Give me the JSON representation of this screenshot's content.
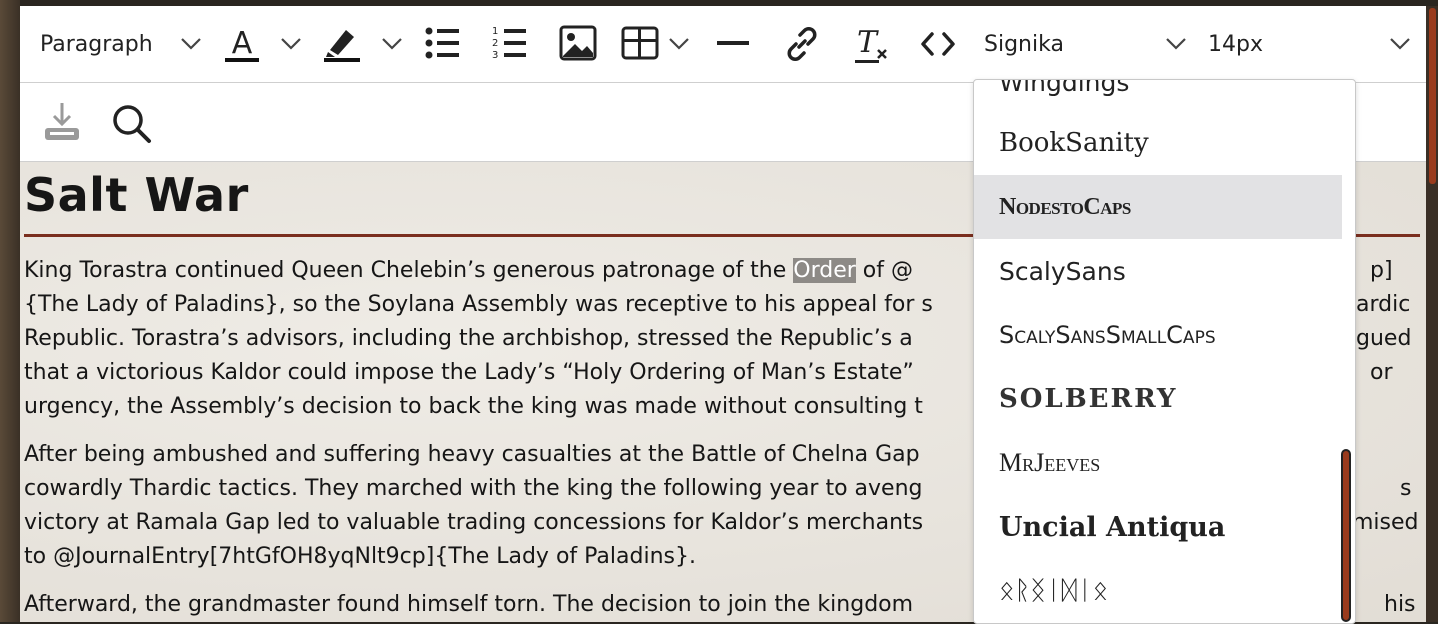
{
  "toolbar": {
    "block_format": "Paragraph",
    "font_family": "Signika",
    "font_size": "14px"
  },
  "document": {
    "title": "Salt War",
    "paragraph1": {
      "line1_before": "King Torastra continued Queen Chelebin’s generous patronage of the ",
      "line1_highlight": "Order",
      "line1_after": " of @",
      "line1_right": "p]",
      "line2": "{The Lady of Paladins}, so the Soylana Assembly was receptive to his appeal for s",
      "line2_right": "ardic",
      "line3": "Republic. Torastra’s advisors, including the archbishop, stressed the Republic’s a",
      "line3_right": "gued",
      "line4": "that a victorious Kaldor could impose the Lady’s “Holy Ordering of Man’s Estate”",
      "line4_right": "or",
      "line5": "urgency, the Assembly’s decision to back the king was made without consulting t"
    },
    "paragraph2": {
      "line1": "After being ambushed and suffering heavy casualties at the Battle of Chelna Gap",
      "line2": "cowardly Thardic tactics. They marched with the king the following year to aveng",
      "line2_right": "s",
      "line3": "victory at Ramala Gap led to valuable trading concessions for Kaldor’s merchants",
      "line3_right": "mised",
      "line4": "to @JournalEntry[7htGfOH8yqNlt9cp]{The Lady of Paladins}."
    },
    "paragraph3": {
      "line1": "Afterward, the grandmaster found himself torn. The decision to join the kingdom",
      "line1_right": "his"
    }
  },
  "font_dropdown": {
    "items": [
      "Wingdings",
      "BookSanity",
      "NodestoCaps",
      "ScalySans",
      "ScalySansSmallCaps",
      "SOLBERRY",
      "MrJeeves",
      "Uncial Antiqua",
      "ᛟᚱᛝᛁᛞᛁᛟ"
    ],
    "selected": "NodestoCaps"
  },
  "colors": {
    "accent_rule": "#7a2e1e",
    "scroll_thumb": "#9a3b1d",
    "selected_bg": "#e2e2e4"
  }
}
